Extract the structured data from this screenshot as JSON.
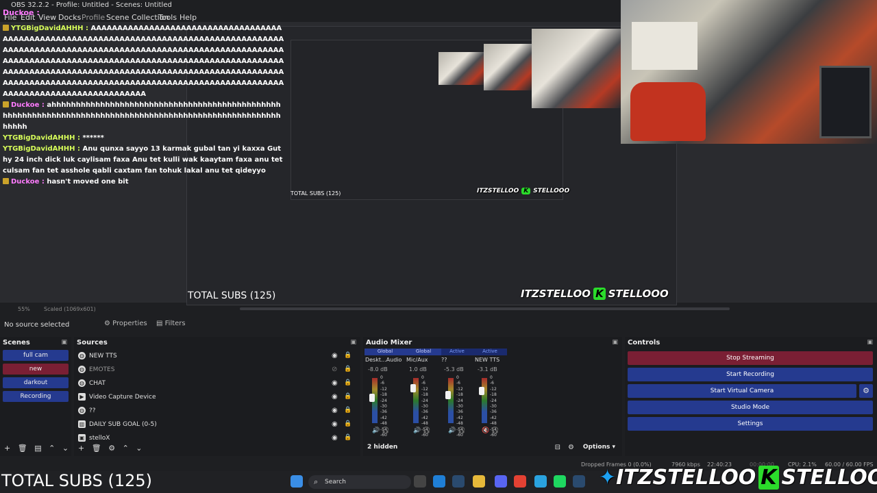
{
  "window": {
    "title": "OBS 32.2.2 - Profile: Untitled - Scenes: Untitled",
    "overlay_name": "Duckoe :"
  },
  "menu": [
    "File",
    "Edit",
    "View",
    "Docks",
    "Profile",
    "Scene Collection",
    "Tools",
    "Help"
  ],
  "chat": [
    {
      "user": "YTGBigDavidAHHH :",
      "text": "AAAAAAAAAAAAAAAAAAAAAAAAAAAAAAAAAAAAAAAAAAAAAAAAAAAAAAAAAAAAAAAAAAAAAAAAAAAAAAAAAAAAAAAAAAAAAAAAAAAAAAAAAAAAAAAAAAAAAAAAAAAAAAAAAAAAAAAAAAAAAAAAAAAAAAAAAAAAAAAAAAAAAAAAAAAAAAAAAAAAAAAAAAAAAAAAAAAAAAAAAAAAAAAAAAAAAAAAAAAAAAAAAAAAAAAAAAAAAAAAAAAAAAAAAAAAAAAAAAAAAAAAAAAAAAAAAAAAAAAAAAAAAAAAAAAAAAAAAAAAAAAAAAAAAAAAAAAAAAAAAAAAAAAA",
      "color": "y"
    },
    {
      "user": "Duckoe :",
      "text": "ahhhhhhhhhhhhhhhhhhhhhhhhhhhhhhhhhhhhhhhhhhhhhhhhhhhhhhhhhhhhhhhhhhhhhhhhhhhhhhhhhhhhhhhhhhhhhhhhhhhhhhhhhhhhh",
      "color": "d"
    },
    {
      "user": "YTGBigDavidAHHH :",
      "text": "******",
      "color": "y"
    },
    {
      "user": "YTGBigDavidAHHH :",
      "text": "Anu qunxa sayyo 13 karmak gubal tan yi kaxxa Guthy 24 inch dick luk caylisam faxa Anu tet kulli wak kaaytam faxa anu tet culsam fan tet asshole qabli caxtam fan tohuk lakal anu tet qideyyo",
      "color": "y"
    },
    {
      "user": "Duckoe :",
      "text": "hasn't moved one bit",
      "color": "d"
    }
  ],
  "preview": {
    "zoom": "55%",
    "scaled": "Scaled (1069x601)",
    "subs_label": "TOTAL SUBS (125)",
    "brand_left": "ITZSTELLOO",
    "brand_k": "K",
    "brand_right": "STELLOOO"
  },
  "source_bar": {
    "label": "No source selected",
    "properties": "Properties",
    "filters": "Filters"
  },
  "docks": {
    "scenes_title": "Scenes",
    "sources_title": "Sources",
    "mixer_title": "Audio Mixer",
    "controls_title": "Controls"
  },
  "scenes": [
    {
      "name": "full cam",
      "selected": false
    },
    {
      "name": "new",
      "selected": true
    },
    {
      "name": "darkout",
      "selected": false
    },
    {
      "name": "Recording",
      "selected": false
    }
  ],
  "sources": [
    {
      "name": "NEW TTS",
      "icon": "globe-icon",
      "visible": true
    },
    {
      "name": "EMOTES",
      "icon": "globe-icon",
      "visible": false
    },
    {
      "name": "CHAT",
      "icon": "globe-icon",
      "visible": true
    },
    {
      "name": "Video Capture Device",
      "icon": "camera-icon",
      "visible": true
    },
    {
      "name": "??",
      "icon": "globe-icon",
      "visible": true
    },
    {
      "name": "DAILY SUB GOAL (0-5)",
      "icon": "chart-icon",
      "visible": true
    },
    {
      "name": "stelloX",
      "icon": "image-icon",
      "visible": true
    }
  ],
  "mixer": {
    "tabs": [
      {
        "label": "Global",
        "active": false
      },
      {
        "label": "Global",
        "active": false
      },
      {
        "label": "Active",
        "active": true
      },
      {
        "label": "Active",
        "active": true
      }
    ],
    "channels": [
      {
        "name": "Deskt...Audio",
        "db": "-8.0 dB",
        "fader": 0.62
      },
      {
        "name": "Mic/Aux",
        "db": "1.0 dB",
        "fader": 0.85
      },
      {
        "name": "??",
        "db": "-5.3 dB",
        "fader": 0.68
      },
      {
        "name": "NEW TTS",
        "db": "-3.1 dB",
        "fader": 0.78
      }
    ],
    "scale": [
      "0",
      "-6",
      "-12",
      "-18",
      "-24",
      "-30",
      "-36",
      "-42",
      "-48",
      "-54",
      "-60"
    ],
    "hidden": "2 hidden",
    "options": "Options"
  },
  "controls": [
    {
      "label": "Stop Streaming",
      "stop": true
    },
    {
      "label": "Start Recording",
      "stop": false
    },
    {
      "label": "Start Virtual Camera",
      "stop": false
    },
    {
      "label": "Studio Mode",
      "stop": false
    },
    {
      "label": "Settings",
      "stop": false
    }
  ],
  "status": {
    "dropped": "Dropped Frames 0 (0.0%)",
    "bitrate": "7960 kbps",
    "stream_time": "22:40:23",
    "rec_time": "00:00:00",
    "cpu": "CPU: 2.1%",
    "fps": "60.00 / 60.00 FPS"
  },
  "taskbar": {
    "search": "Search"
  },
  "colors": {
    "accent": "#253a8f",
    "stop": "#7a1f34",
    "bg": "#1e1f22"
  }
}
